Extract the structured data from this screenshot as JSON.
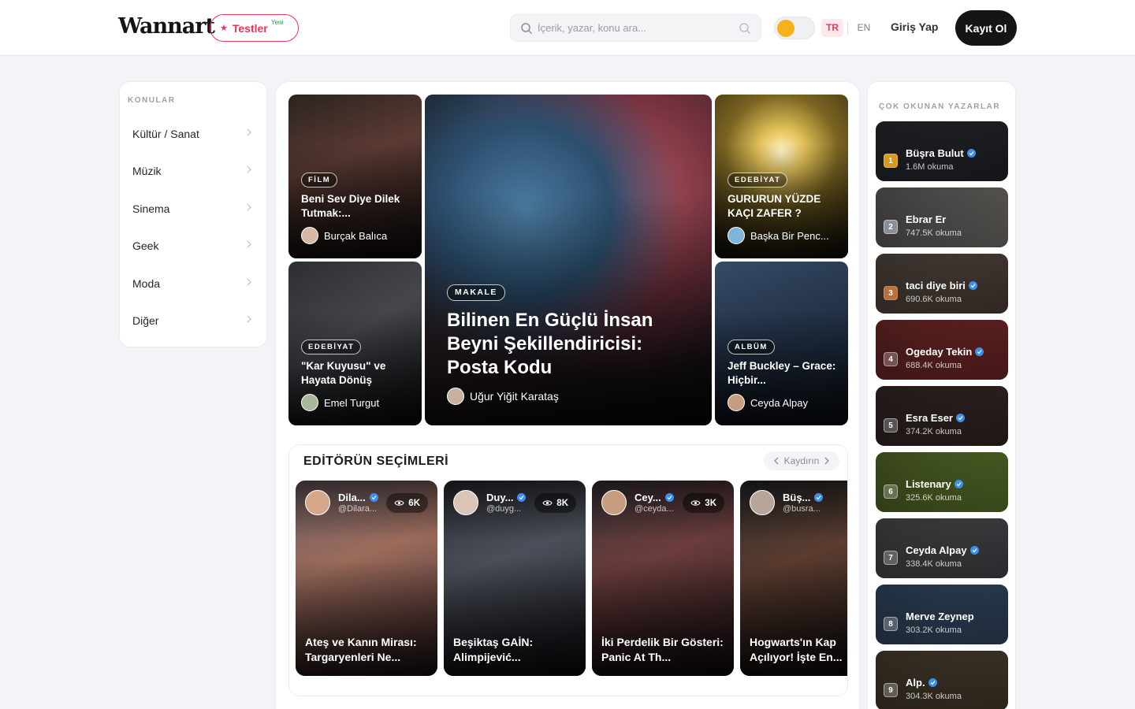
{
  "header": {
    "logo": "Wannart",
    "tests_label": "Testler",
    "tests_badge": "Yeni",
    "search_placeholder": "İçerik, yazar, konu ara...",
    "lang_tr": "TR",
    "lang_en": "EN",
    "login": "Giriş Yap",
    "signup": "Kayıt Ol"
  },
  "topics": {
    "title": "KONULAR",
    "items": [
      "Kültür / Sanat",
      "Müzik",
      "Sinema",
      "Geek",
      "Moda",
      "Diğer"
    ]
  },
  "featured": [
    {
      "tag": "FİLM",
      "title": "Beni Sev Diye Dilek Tutmak:...",
      "author": "Burçak Balıca"
    },
    {
      "tag": "EDEBİYAT",
      "title": "\"Kar Kuyusu\" ve Hayata Dönüş",
      "author": "Emel Turgut"
    },
    {
      "tag": "MAKALE",
      "title": "Bilinen En Güçlü İnsan Beyni Şekillendiricisi: Posta Kodu",
      "author": "Uğur Yiğit Karataş"
    },
    {
      "tag": "EDEBİYAT",
      "title": "GURURUN YÜZDE KAÇI ZAFER ?",
      "author": "Başka Bir Penc..."
    },
    {
      "tag": "ALBÜM",
      "title": "Jeff Buckley – Grace: Hiçbir...",
      "author": "Ceyda Alpay"
    }
  ],
  "editors": {
    "title": "EDİTÖRÜN SEÇİMLERİ",
    "scroll_label": "Kaydırın",
    "cards": [
      {
        "name": "Dila...",
        "handle": "@Dilara...",
        "views": "6K",
        "title": "Ateş ve Kanın Mirası: Targaryenleri Ne..."
      },
      {
        "name": "Duy...",
        "handle": "@duyg...",
        "views": "8K",
        "title": "Beşiktaş GAİN: Alimpijević..."
      },
      {
        "name": "Cey...",
        "handle": "@ceyda...",
        "views": "3K",
        "title": "İki Perdelik Bir Gösteri: Panic At Th..."
      },
      {
        "name": "Büş...",
        "handle": "@busra...",
        "views": "",
        "title": "Hogwarts'ın Kap Açılıyor! İşte En..."
      }
    ]
  },
  "authors": {
    "title": "ÇOK OKUNAN YAZARLAR",
    "items": [
      {
        "rank": "1",
        "name": "Büşra Bulut",
        "reads": "1.6M okuma",
        "verified": true
      },
      {
        "rank": "2",
        "name": "Ebrar Er",
        "reads": "747.5K okuma",
        "verified": false
      },
      {
        "rank": "3",
        "name": "taci diye biri",
        "reads": "690.6K okuma",
        "verified": true
      },
      {
        "rank": "4",
        "name": "Ogeday Tekin",
        "reads": "688.4K okuma",
        "verified": true
      },
      {
        "rank": "5",
        "name": "Esra Eser",
        "reads": "374.2K okuma",
        "verified": true
      },
      {
        "rank": "6",
        "name": "Listenary",
        "reads": "325.6K okuma",
        "verified": true
      },
      {
        "rank": "7",
        "name": "Ceyda Alpay",
        "reads": "338.4K okuma",
        "verified": true
      },
      {
        "rank": "8",
        "name": "Merve Zeynep",
        "reads": "303.2K okuma",
        "verified": false
      },
      {
        "rank": "9",
        "name": "Alp.",
        "reads": "304.3K okuma",
        "verified": true
      }
    ]
  },
  "colors": {
    "accent": "#e23a55",
    "dark": "#151517",
    "verified": "#3b8fee",
    "toggle_knob": "#f6b21a"
  }
}
